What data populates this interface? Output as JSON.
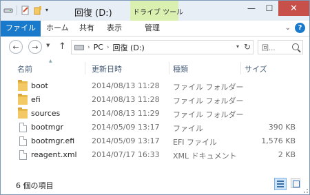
{
  "window": {
    "title": "回復 (D:)"
  },
  "context_tab_group": {
    "label": "ドライブ ツール"
  },
  "quick_access_toolbar": {
    "icons": [
      "drive-icon",
      "properties-icon",
      "new-folder-icon",
      "customize-dropdown-icon"
    ]
  },
  "ribbon_tabs": [
    {
      "label": "ファイル"
    },
    {
      "label": "ホーム"
    },
    {
      "label": "共有"
    },
    {
      "label": "表示"
    },
    {
      "label": "管理"
    }
  ],
  "address_bar": {
    "segments": [
      "PC",
      "回復 (D:)"
    ],
    "icon": "drive-icon"
  },
  "search": {
    "placeholder": "回..."
  },
  "columns": [
    "名前",
    "更新日時",
    "種類",
    "サイズ"
  ],
  "files": [
    {
      "name": "boot",
      "date": "2014/08/13 11:28",
      "type": "ファイル フォルダー",
      "size": "",
      "icon": "folder-icon"
    },
    {
      "name": "efi",
      "date": "2014/08/13 11:28",
      "type": "ファイル フォルダー",
      "size": "",
      "icon": "folder-icon"
    },
    {
      "name": "sources",
      "date": "2014/08/13 11:29",
      "type": "ファイル フォルダー",
      "size": "",
      "icon": "folder-icon"
    },
    {
      "name": "bootmgr",
      "date": "2014/05/09 13:17",
      "type": "ファイル",
      "size": "390 KB",
      "icon": "file-icon"
    },
    {
      "name": "bootmgr.efi",
      "date": "2014/05/09 13:17",
      "type": "EFI ファイル",
      "size": "1,576 KB",
      "icon": "file-icon"
    },
    {
      "name": "reagent.xml",
      "date": "2014/07/17 16:33",
      "type": "XML ドキュメント",
      "size": "2 KB",
      "icon": "file-icon"
    }
  ],
  "status_bar": {
    "item_count": "6 個の項目"
  },
  "colors": {
    "file_tab": "#1979ca",
    "close_button": "#c7514a",
    "context_group": "#d9f0b0",
    "folder": "#f2c964"
  }
}
